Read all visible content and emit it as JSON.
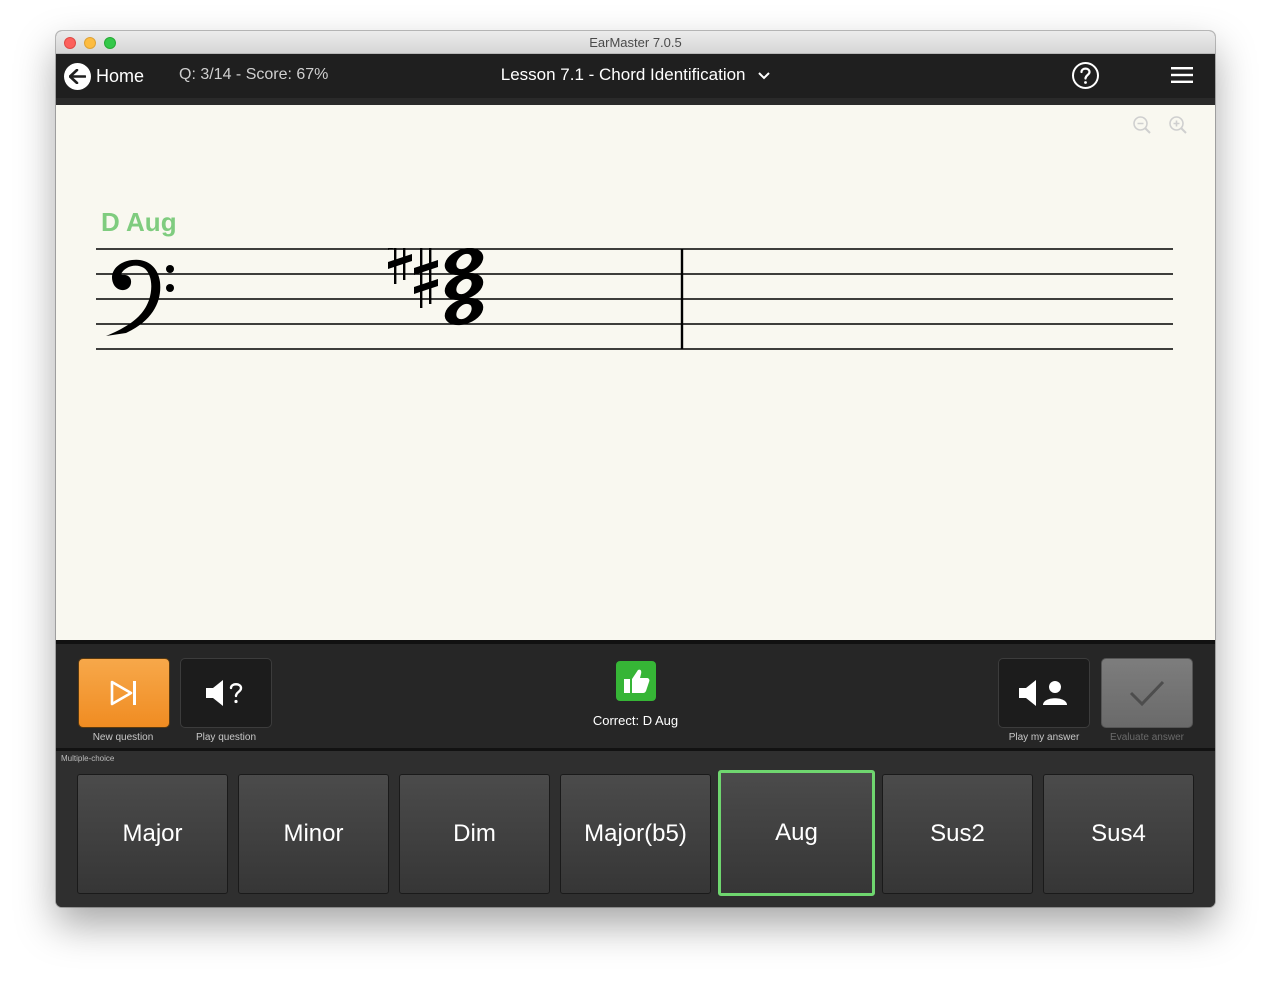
{
  "window": {
    "title": "EarMaster 7.0.5"
  },
  "appbar": {
    "home_label": "Home",
    "score_text": "Q: 3/14 - Score: 67%",
    "lesson_title": "Lesson 7.1 - Chord Identification"
  },
  "progress": {
    "segments": [
      "red",
      "green",
      "green-current",
      "pending",
      "pending",
      "pending",
      "pending",
      "pending",
      "pending",
      "pending",
      "pending",
      "pending",
      "pending",
      "pending",
      "locked",
      "locked",
      "locked",
      "locked",
      "locked",
      "locked",
      "locked",
      "locked",
      "locked",
      "locked",
      "locked",
      "locked",
      "locked",
      "locked",
      "locked",
      "locked",
      "locked",
      "locked",
      "locked",
      "locked"
    ]
  },
  "colors": {
    "red": "#e8474d",
    "green": "#6aa84f",
    "pending": "#c9ccd8",
    "locked": "#9a9c88",
    "chord_label": "#7fcc7f",
    "selected_border": "#6fd66f"
  },
  "score": {
    "chord_label": "D Aug",
    "clef": "bass-clef",
    "notes": [
      "D",
      "F#",
      "A#"
    ]
  },
  "controls": {
    "new_question": "New question",
    "play_question": "Play question",
    "play_my_answer": "Play my answer",
    "evaluate_answer": "Evaluate answer",
    "feedback": "Correct: D Aug"
  },
  "answers": {
    "section_label": "Multiple-choice",
    "options": [
      "Major",
      "Minor",
      "Dim",
      "Major(b5)",
      "Aug",
      "Sus2",
      "Sus4"
    ],
    "selected": "Aug"
  }
}
